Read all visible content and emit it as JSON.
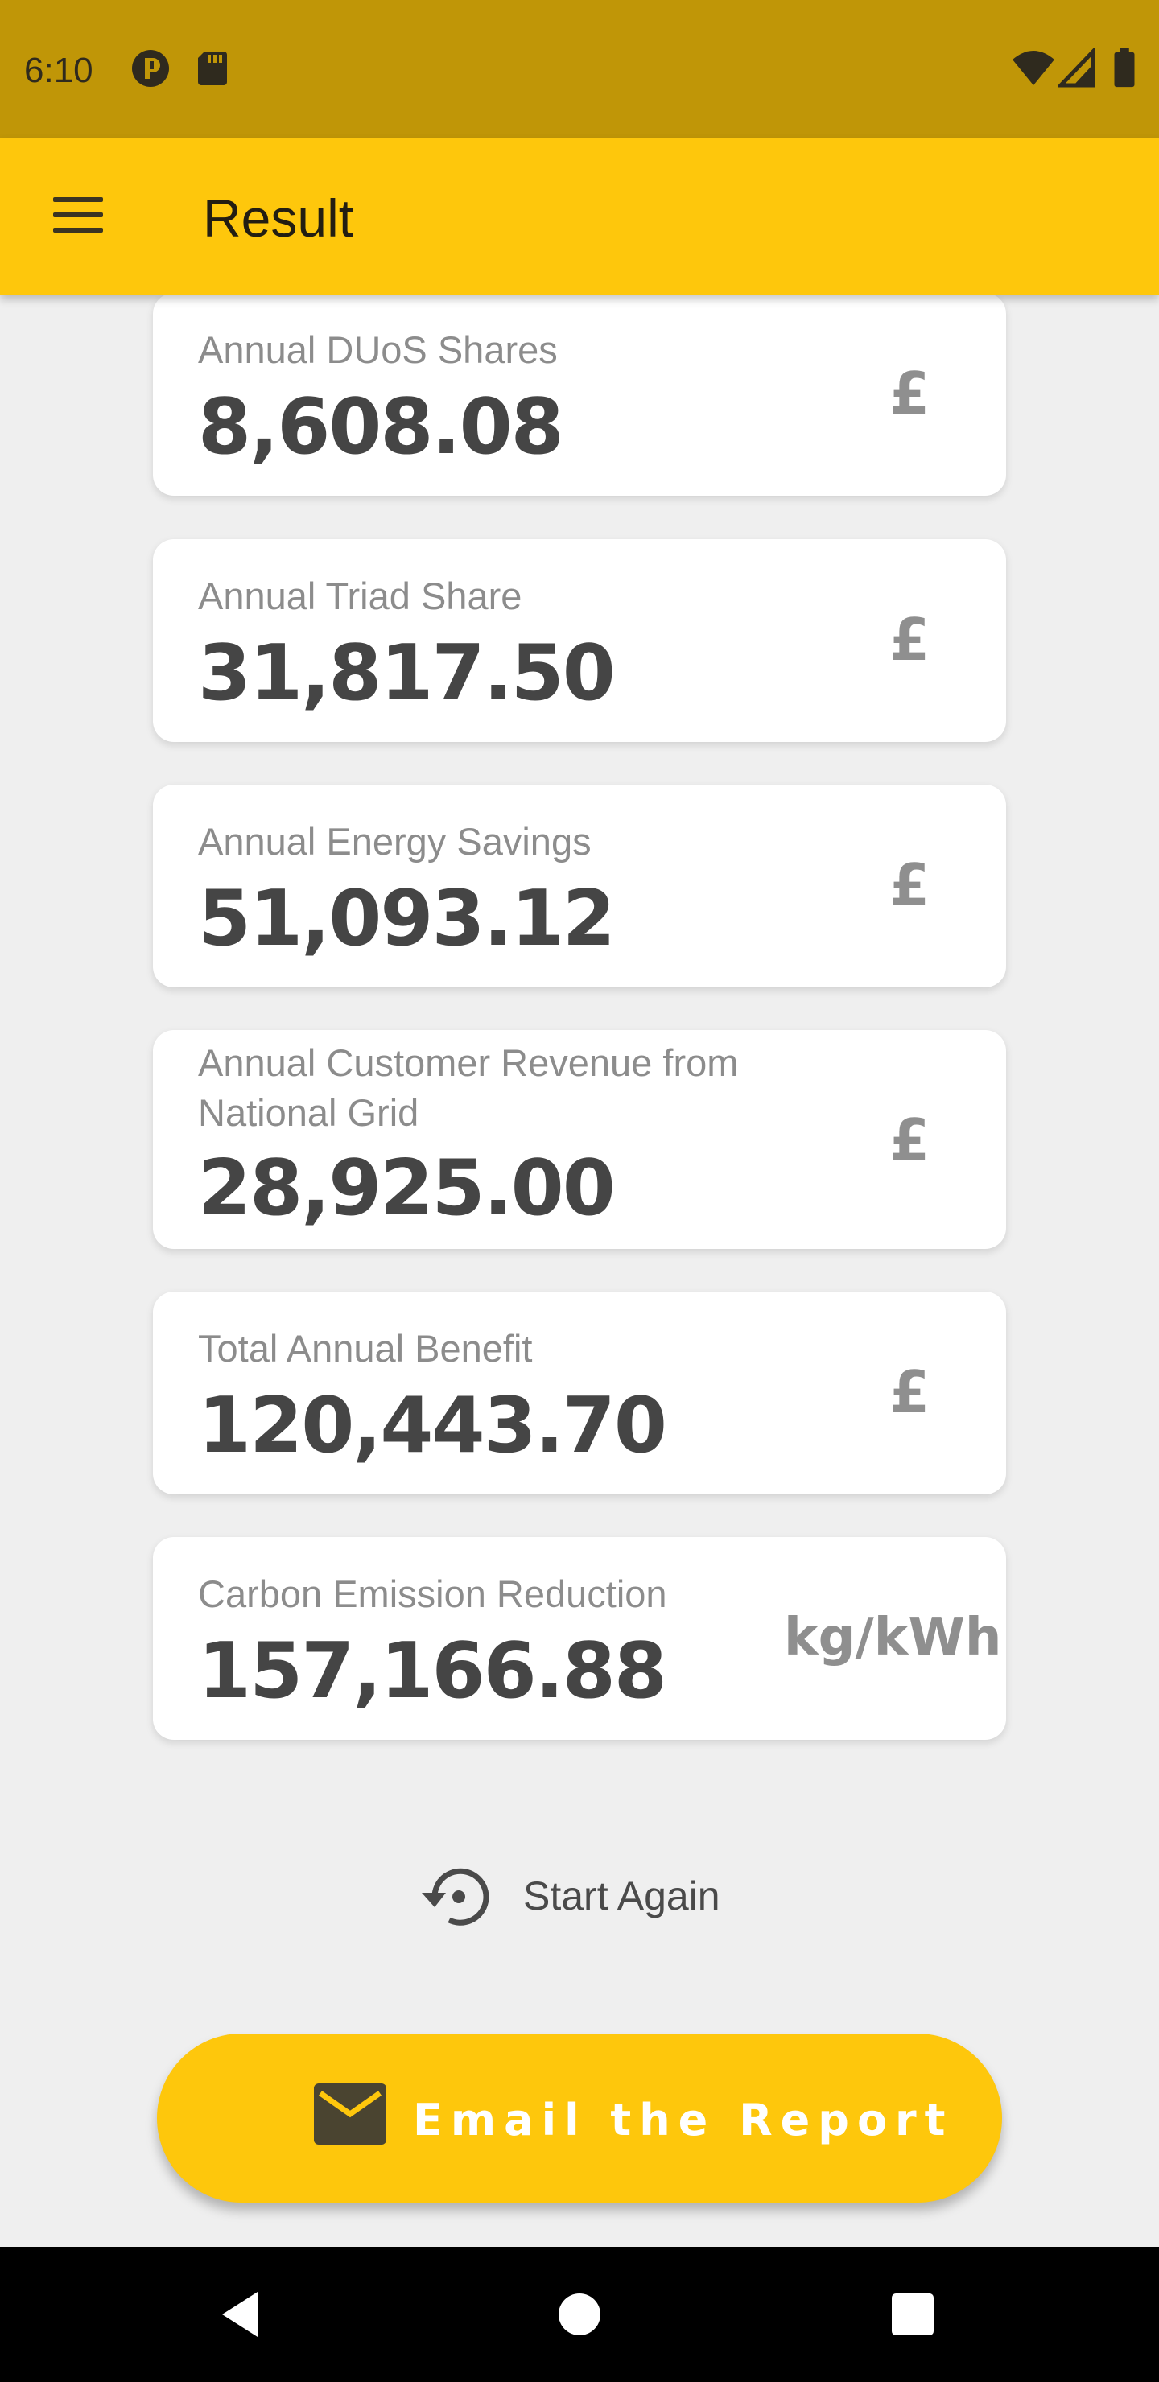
{
  "status_bar": {
    "time": "6:10",
    "icons": [
      "app-notification-icon",
      "sd-card-icon",
      "wifi-icon",
      "signal-icon",
      "battery-icon"
    ]
  },
  "app_bar": {
    "menu_icon": "menu-icon",
    "title": "Result"
  },
  "results": [
    {
      "label": "Annual DUoS Shares",
      "value": "8,608.08",
      "unit": "£"
    },
    {
      "label": "Annual Triad Share",
      "value": "31,817.50",
      "unit": "£"
    },
    {
      "label": "Annual Energy Savings",
      "value": "51,093.12",
      "unit": "£"
    },
    {
      "label": "Annual Customer Revenue from National Grid",
      "value": "28,925.00",
      "unit": "£"
    },
    {
      "label": "Total Annual Benefit",
      "value": "120,443.70",
      "unit": "£"
    },
    {
      "label": "Carbon Emission Reduction",
      "value": "157,166.88",
      "unit": "kg/kWh"
    }
  ],
  "actions": {
    "start_again_label": "Start Again",
    "start_again_icon": "restart-icon",
    "email_label": "Email the Report",
    "email_icon": "mail-icon"
  },
  "nav_bar": {
    "icons": [
      "back-icon",
      "home-icon",
      "recents-icon"
    ]
  },
  "colors": {
    "accent": "#fec70c",
    "status_bar": "#c09607"
  }
}
